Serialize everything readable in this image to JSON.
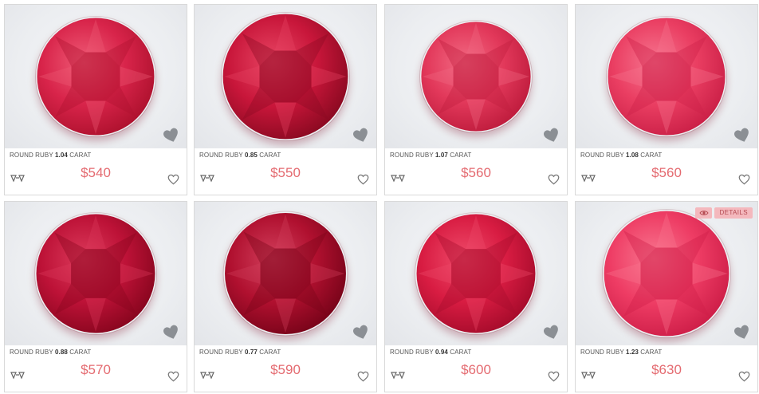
{
  "products": [
    {
      "caption_prefix": "ROUND RUBY",
      "carat": "1.04",
      "caption_suffix": "CARAT",
      "price": "$540",
      "color": "#d8244a",
      "dark": "#b0122f",
      "light": "#ef5b76"
    },
    {
      "caption_prefix": "ROUND RUBY",
      "carat": "0.85",
      "caption_suffix": "CARAT",
      "price": "$550",
      "color": "#c8163a",
      "dark": "#8d0a22",
      "light": "#e84563"
    },
    {
      "caption_prefix": "ROUND RUBY",
      "carat": "1.07",
      "caption_suffix": "CARAT",
      "price": "$560",
      "color": "#e2385a",
      "dark": "#c01d3e",
      "light": "#f26a83"
    },
    {
      "caption_prefix": "ROUND RUBY",
      "carat": "1.08",
      "caption_suffix": "CARAT",
      "price": "$560",
      "color": "#ea3e62",
      "dark": "#cc2148",
      "light": "#f6758f"
    },
    {
      "caption_prefix": "ROUND RUBY",
      "carat": "0.88",
      "caption_suffix": "CARAT",
      "price": "$570",
      "color": "#bd1237",
      "dark": "#8a061f",
      "light": "#dc3a5b"
    },
    {
      "caption_prefix": "ROUND RUBY",
      "carat": "0.77",
      "caption_suffix": "CARAT",
      "price": "$590",
      "color": "#b0102f",
      "dark": "#7a041a",
      "light": "#d23f5c"
    },
    {
      "caption_prefix": "ROUND RUBY",
      "carat": "0.94",
      "caption_suffix": "CARAT",
      "price": "$600",
      "color": "#d81c42",
      "dark": "#a80c2c",
      "light": "#ef4b6a"
    },
    {
      "caption_prefix": "ROUND RUBY",
      "carat": "1.23",
      "caption_suffix": "CARAT",
      "price": "$630",
      "color": "#ee3c64",
      "dark": "#cf1f49",
      "light": "#f8768f"
    }
  ],
  "hover_card": {
    "details_label": "DETAILS"
  },
  "icons": {
    "compare": "compare-diamond-icon",
    "favorite": "heart-outline-icon",
    "badge": "heart-badge-icon",
    "quick_view": "eye-icon"
  },
  "accent": "#e46a70"
}
